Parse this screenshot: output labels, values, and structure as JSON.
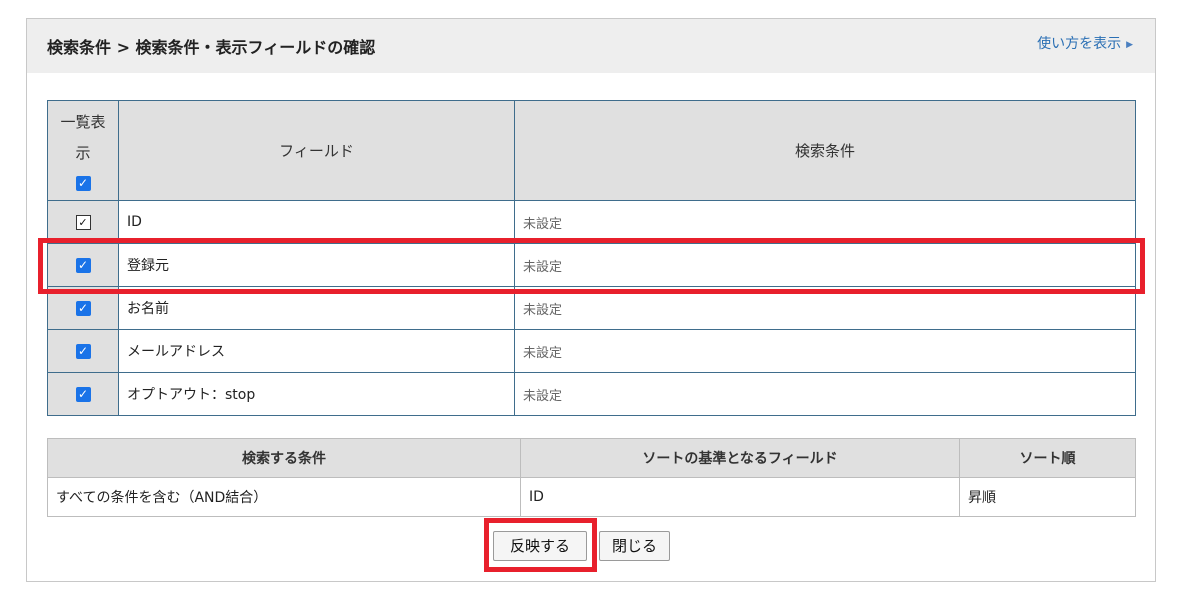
{
  "header": {
    "title": "検索条件 > 検索条件・表示フィールドの確認",
    "help_link": "使い方を表示",
    "help_arrow": "▶"
  },
  "fields_table": {
    "col_display": "一覧表示",
    "col_field": "フィールド",
    "col_condition": "検索条件",
    "rows": [
      {
        "field": "ID",
        "condition": "未設定",
        "checked": true
      },
      {
        "field": "登録元",
        "condition": "未設定",
        "checked": true
      },
      {
        "field": "お名前",
        "condition": "未設定",
        "checked": true
      },
      {
        "field": "メールアドレス",
        "condition": "未設定",
        "checked": true
      },
      {
        "field": "オプトアウト：stop",
        "condition": "未設定",
        "checked": true
      }
    ]
  },
  "sort_table": {
    "col_match": "検索する条件",
    "col_sort_field": "ソートの基準となるフィールド",
    "col_order": "ソート順",
    "match": "すべての条件を含む（AND結合）",
    "sort_field": "ID",
    "order": "昇順"
  },
  "buttons": {
    "apply": "反映する",
    "close": "閉じる"
  },
  "checkmark": "✓",
  "colors": {
    "highlight": "#e8202c",
    "checkbox": "#1a73e8",
    "link": "#2a6fb4"
  }
}
